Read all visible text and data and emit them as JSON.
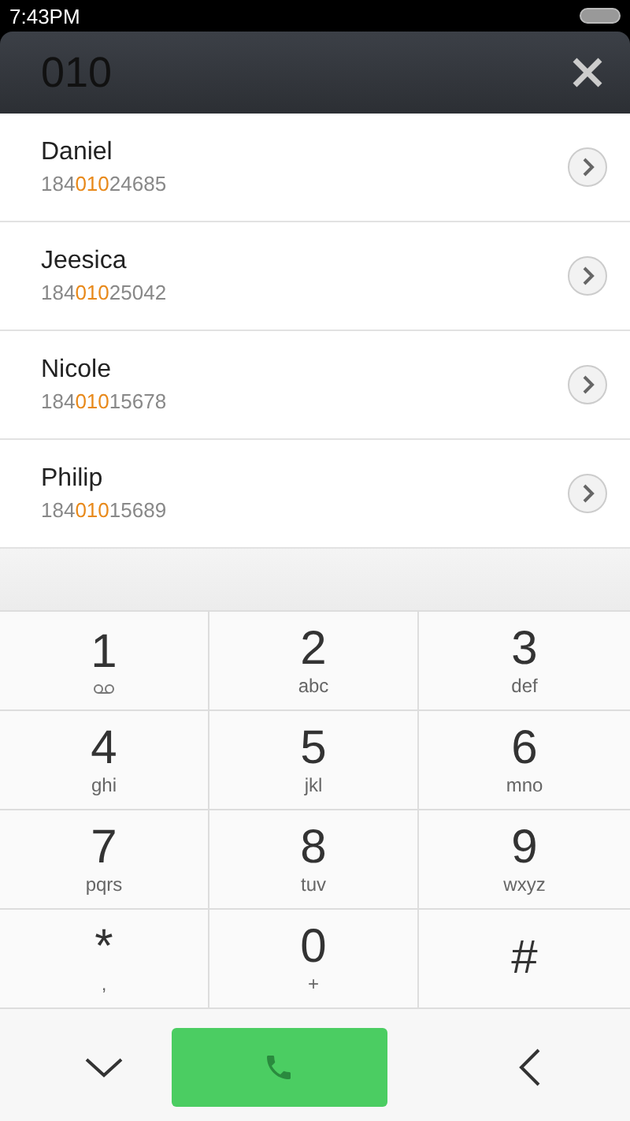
{
  "status_bar": {
    "time": "7:43PM"
  },
  "search": {
    "value": "010"
  },
  "contacts": [
    {
      "name": "Daniel",
      "number": [
        {
          "text": "184",
          "match": false
        },
        {
          "text": "010",
          "match": true
        },
        {
          "text": "24685",
          "match": false
        }
      ]
    },
    {
      "name": "Jeesica",
      "number": [
        {
          "text": "184",
          "match": false
        },
        {
          "text": "010",
          "match": true
        },
        {
          "text": "25042",
          "match": false
        }
      ]
    },
    {
      "name": "Nicole",
      "number": [
        {
          "text": "184",
          "match": false
        },
        {
          "text": "010",
          "match": true
        },
        {
          "text": "15678",
          "match": false
        }
      ]
    },
    {
      "name": "Philip",
      "number": [
        {
          "text": "184",
          "match": false
        },
        {
          "text": "010",
          "match": true
        },
        {
          "text": "15689",
          "match": false
        }
      ]
    }
  ],
  "keypad": [
    {
      "digit": "1",
      "kind": "voicemail"
    },
    {
      "digit": "2",
      "letters": "abc",
      "kind": "letters"
    },
    {
      "digit": "3",
      "letters": "def",
      "kind": "letters"
    },
    {
      "digit": "4",
      "letters": "ghi",
      "kind": "letters"
    },
    {
      "digit": "5",
      "letters": "jkl",
      "kind": "letters"
    },
    {
      "digit": "6",
      "letters": "mno",
      "kind": "letters"
    },
    {
      "digit": "7",
      "letters": "pqrs",
      "kind": "letters"
    },
    {
      "digit": "8",
      "letters": "tuv",
      "kind": "letters"
    },
    {
      "digit": "9",
      "letters": "wxyz",
      "kind": "letters"
    },
    {
      "digit": "*",
      "letters": ",",
      "kind": "letters"
    },
    {
      "digit": "0",
      "letters": "+",
      "kind": "letters"
    },
    {
      "digit": "#",
      "kind": "plain"
    }
  ]
}
